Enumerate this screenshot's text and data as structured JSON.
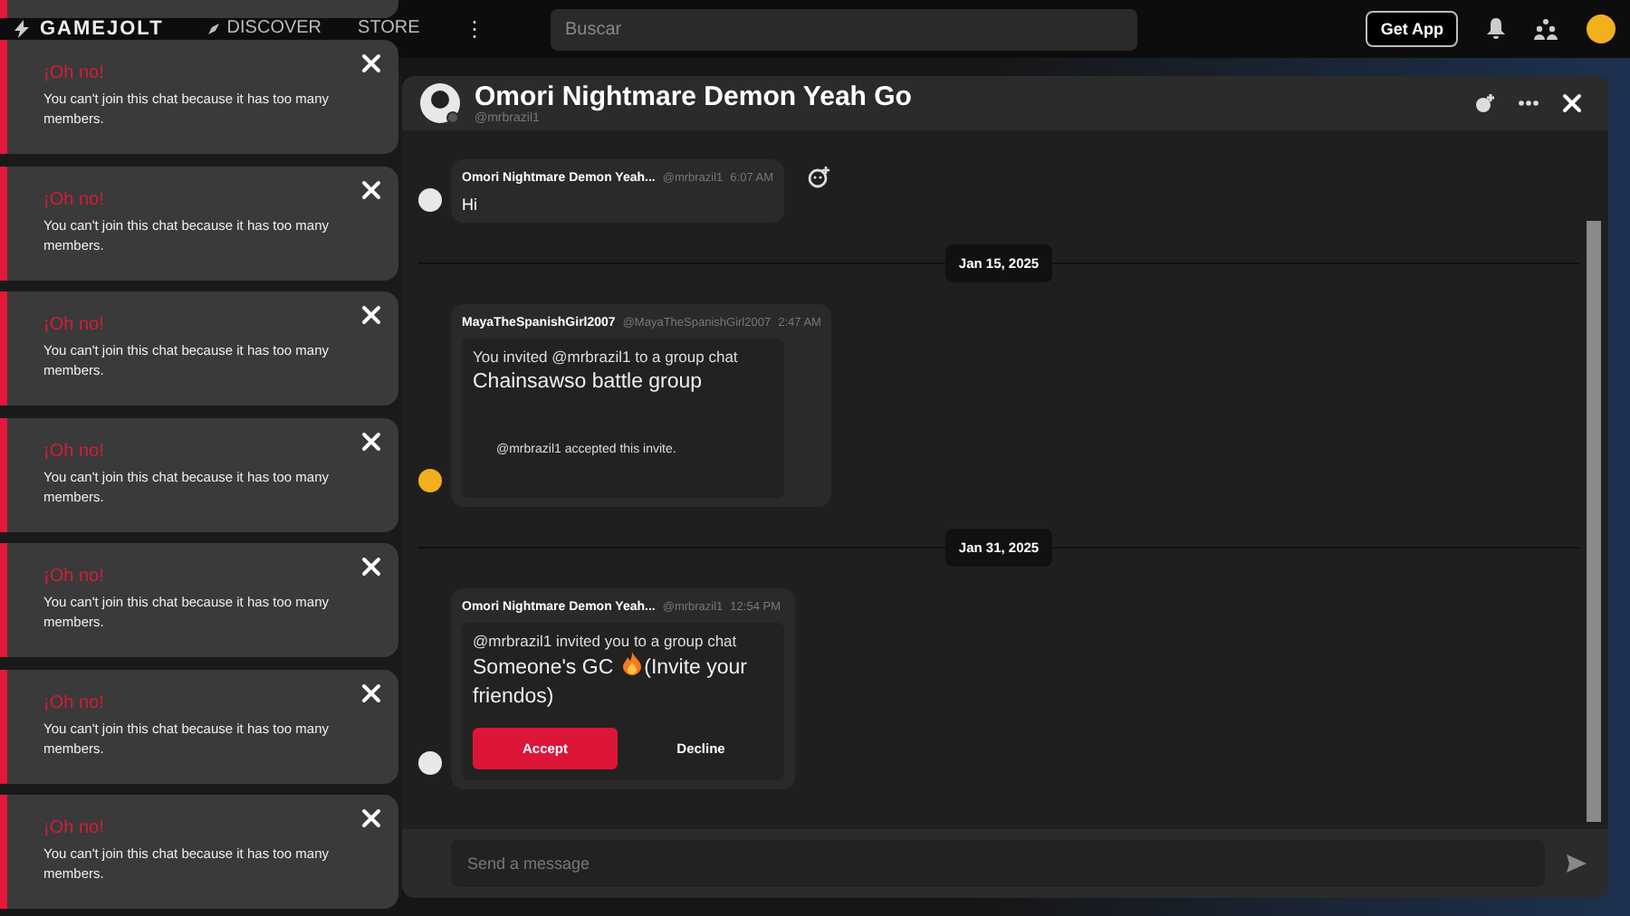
{
  "top_bar": {
    "logo": "GAMEJOLT",
    "nav": [
      {
        "label": "DISCOVER"
      },
      {
        "label": "STORE"
      }
    ],
    "more": "⋮",
    "search": {
      "placeholder": "Buscar"
    },
    "get_app": "Get App"
  },
  "chat": {
    "title": "Omori Nightmare Demon Yeah Go",
    "handle": "@mrbrazil1",
    "messages": [
      {
        "kind": "text",
        "author": "Omori Nightmare Demon Yeah...",
        "handle": "@mrbrazil1",
        "time": "6:07 AM",
        "text": "Hi",
        "color": "#e8e8e8"
      },
      {
        "kind": "date",
        "label": "Jan 15, 2025"
      },
      {
        "kind": "invite",
        "author": "MayaTheSpanishGirl2007",
        "handle": "@MayaTheSpanishGirl2007",
        "time": "2:47 AM",
        "invite_line": "You invited @mrbrazil1 to a group chat",
        "group": "Chainsawso battle group",
        "status": "@mrbrazil1 accepted this invite.",
        "color": "#f2b01e"
      },
      {
        "kind": "date",
        "label": "Jan 31, 2025"
      },
      {
        "kind": "invite",
        "author": "Omori Nightmare Demon Yeah...",
        "handle": "@mrbrazil1",
        "time": "12:54 PM",
        "invite_line": "@mrbrazil1 invited you to a group chat",
        "group": "Someone's GC",
        "group_suffix": [
          "(Invite your",
          "friendos)"
        ],
        "actions": [
          {
            "label": "Accept",
            "kind": "primary"
          },
          {
            "label": "Decline",
            "kind": "plain"
          }
        ],
        "color": "#e8e8e8"
      }
    ],
    "composer": {
      "placeholder": "Send a message"
    }
  },
  "toasts": [
    {
      "title": "¡Oh no!",
      "message": "You can't join this chat because it has too many members."
    },
    {
      "title": "¡Oh no!",
      "message": "You can't join this chat because it has too many members."
    },
    {
      "title": "¡Oh no!",
      "message": "You can't join this chat because it has too many members."
    },
    {
      "title": "¡Oh no!",
      "message": "You can't join this chat because it has too many members."
    },
    {
      "title": "¡Oh no!",
      "message": "You can't join this chat because it has too many members."
    },
    {
      "title": "¡Oh no!",
      "message": "You can't join this chat because it has too many members."
    },
    {
      "title": "¡Oh no!",
      "message": "You can't join this chat because it has too many members."
    }
  ]
}
